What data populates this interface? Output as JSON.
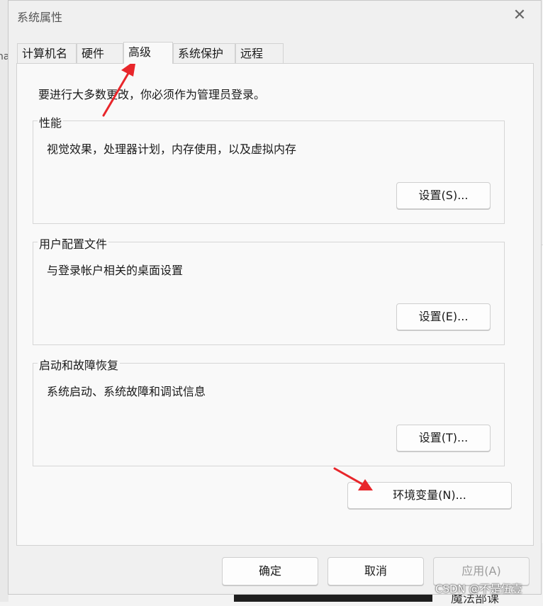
{
  "window": {
    "title": "系统属性",
    "close_glyph": "✕"
  },
  "tabs": [
    {
      "label": "计算机名",
      "active": false
    },
    {
      "label": "硬件",
      "active": false
    },
    {
      "label": "高级",
      "active": true
    },
    {
      "label": "系统保护",
      "active": false
    },
    {
      "label": "远程",
      "active": false
    }
  ],
  "advanced": {
    "intro": "要进行大多数更改，你必须作为管理员登录。",
    "performance": {
      "title": "性能",
      "description": "视觉效果，处理器计划，内存使用，以及虚拟内存",
      "button": "设置(S)..."
    },
    "user_profiles": {
      "title": "用户配置文件",
      "description": "与登录帐户相关的桌面设置",
      "button": "设置(E)..."
    },
    "startup_recovery": {
      "title": "启动和故障恢复",
      "description": "系统启动、系统故障和调试信息",
      "button": "设置(T)..."
    },
    "env_button": "环境变量(N)..."
  },
  "footer": {
    "ok": "确定",
    "cancel": "取消",
    "apply": "应用(A)"
  },
  "background": {
    "left_fragment": "na",
    "bottom_fragment": "魔法部课",
    "watermark": "CSDN @不是伍壹"
  },
  "annotation_color": "#e8262b"
}
